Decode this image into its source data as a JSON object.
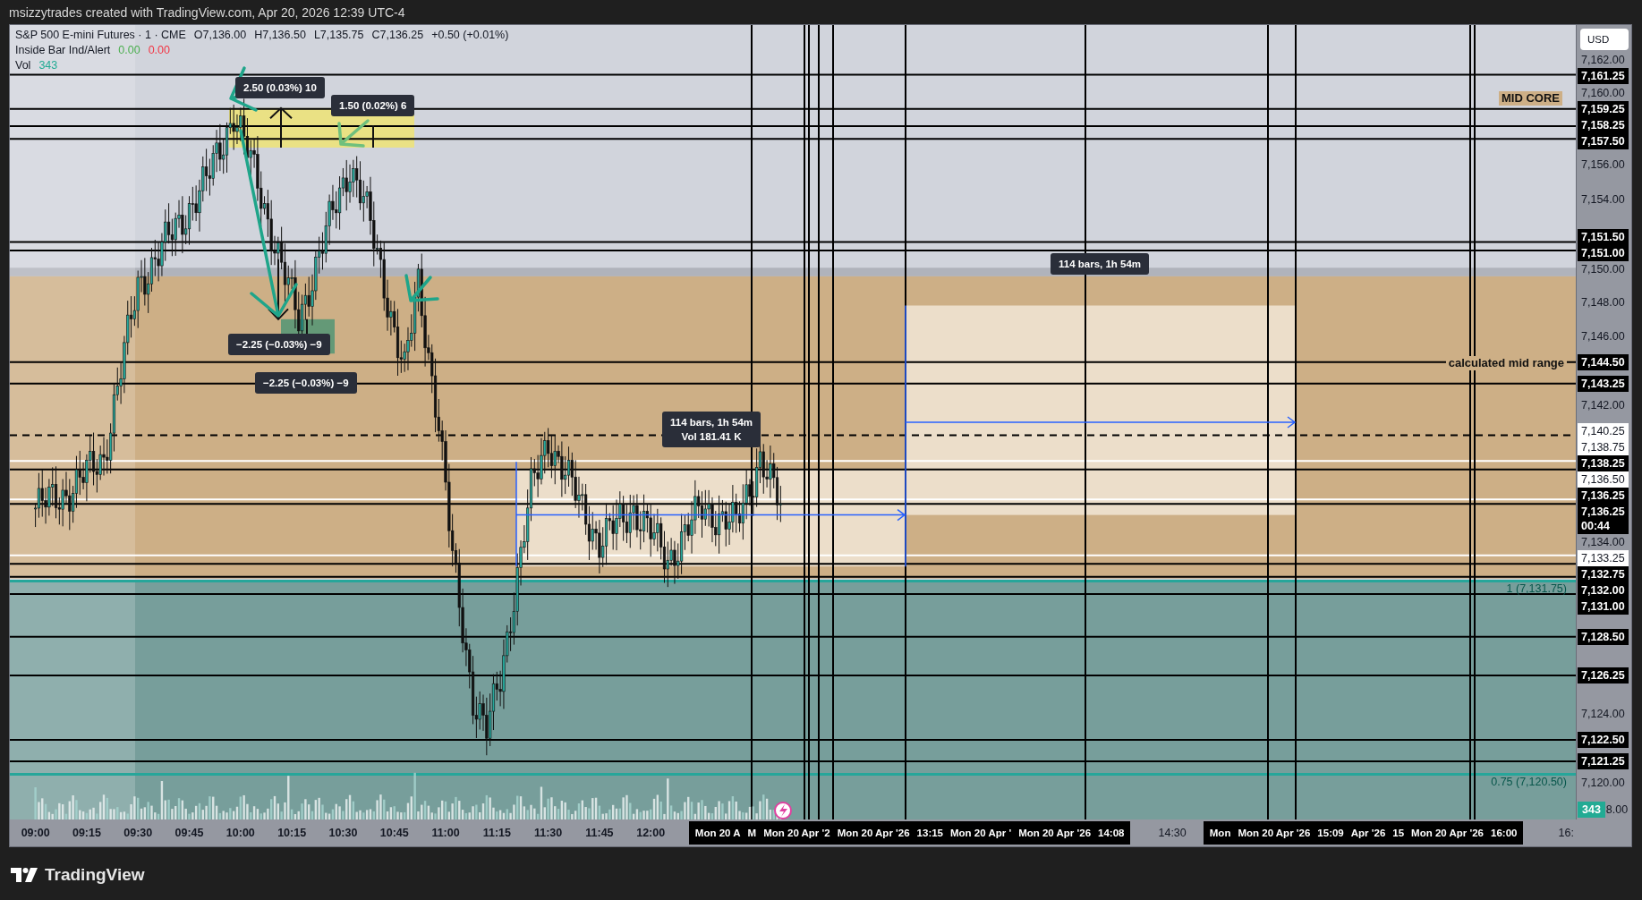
{
  "header": {
    "attribution": "msizzytrades created with TradingView.com, Apr 20, 2026 12:39 UTC-4"
  },
  "legend": {
    "symbol": "S&P 500 E-mini Futures · 1 · CME",
    "ohlc": [
      "O7,136.00",
      "H7,136.50",
      "L7,135.75",
      "C7,136.25"
    ],
    "change": "+0.50 (+0.01%)",
    "indicator": {
      "name": "Inside Bar Ind/Alert",
      "values": [
        {
          "text": "0.00",
          "color": "#4caf50"
        },
        {
          "text": "0.00",
          "color": "#f23645"
        }
      ]
    },
    "volume": {
      "label": "Vol",
      "value": "343"
    }
  },
  "tooltips": [
    {
      "lines": [
        "2.50 (0.03%) 10"
      ]
    },
    {
      "lines": [
        "1.50 (0.02%) 6"
      ]
    },
    {
      "lines": [
        "−2.25 (−0.03%) −9"
      ]
    },
    {
      "lines": [
        "−2.25 (−0.03%) −9"
      ]
    },
    {
      "lines": [
        "114 bars, 1h 54m"
      ]
    },
    {
      "lines": [
        "114 bars, 1h 54m",
        "Vol 181.41 K"
      ]
    }
  ],
  "line_labels": [
    {
      "text": "MID CORE",
      "kind": "bold"
    },
    {
      "text": "calculated mid range",
      "kind": "bold"
    },
    {
      "text": "1 (7,131.75)",
      "kind": "fib"
    },
    {
      "text": "0.75 (7,120.50)",
      "kind": "fib"
    }
  ],
  "price_axis": {
    "currency": "USD",
    "labels": [
      {
        "text": "7,162.00",
        "kind": "tick"
      },
      {
        "text": "7,161.25",
        "kind": "line"
      },
      {
        "text": "7,160.00",
        "kind": "tick"
      },
      {
        "text": "7,159.25",
        "kind": "line"
      },
      {
        "text": "7,158.25",
        "kind": "line"
      },
      {
        "text": "7,157.50",
        "kind": "line"
      },
      {
        "text": "7,156.00",
        "kind": "tick"
      },
      {
        "text": "7,154.00",
        "kind": "tick"
      },
      {
        "text": "7,151.50",
        "kind": "line"
      },
      {
        "text": "7,151.00",
        "kind": "line"
      },
      {
        "text": "7,150.00",
        "kind": "tick"
      },
      {
        "text": "7,148.00",
        "kind": "tick"
      },
      {
        "text": "7,146.00",
        "kind": "tick"
      },
      {
        "text": "7,144.50",
        "kind": "line"
      },
      {
        "text": "7,143.25",
        "kind": "line"
      },
      {
        "text": "7,142.00",
        "kind": "tick"
      },
      {
        "text": "7,140.25",
        "kind": "dashed"
      },
      {
        "text": "7,138.75",
        "kind": "white-line"
      },
      {
        "text": "7,138.25",
        "kind": "line"
      },
      {
        "text": "7,136.50",
        "kind": "white-line"
      },
      {
        "text": "7,136.25",
        "kind": "line"
      },
      {
        "text": "7,136.25",
        "kind": "price",
        "countdown": "00:44"
      },
      {
        "text": "7,134.00",
        "kind": "tick"
      },
      {
        "text": "7,133.25",
        "kind": "white-line"
      },
      {
        "text": "7,132.75",
        "kind": "line"
      },
      {
        "text": "7,132.00",
        "kind": "line"
      },
      {
        "text": "7,131.00",
        "kind": "line"
      },
      {
        "text": "7,128.50",
        "kind": "line"
      },
      {
        "text": "7,126.25",
        "kind": "line"
      },
      {
        "text": "7,124.00",
        "kind": "tick"
      },
      {
        "text": "7,122.50",
        "kind": "line"
      },
      {
        "text": "7,121.25",
        "kind": "line"
      },
      {
        "text": "7,120.00",
        "kind": "tick"
      }
    ],
    "volume_badge": "343",
    "partial_tick": "8.00"
  },
  "time_axis": [
    {
      "kind": "ticks",
      "labels": [
        "09:00",
        "09:15",
        "09:30",
        "09:45",
        "10:00",
        "10:15",
        "10:30",
        "10:45",
        "11:00",
        "11:15",
        "11:30",
        "11:45",
        "12:00"
      ]
    },
    {
      "kind": "cursor",
      "labels": [
        "Mon 20 A",
        "M",
        "Mon 20 Apr '2",
        "Mon 20 Apr '26",
        "13:15",
        "Mon 20 Apr '",
        "Mon 20 Apr '26",
        "14:08"
      ]
    },
    {
      "kind": "ticks",
      "labels": [
        "14:30"
      ]
    },
    {
      "kind": "cursor",
      "labels": [
        "Mon",
        "Mon 20 Apr '26",
        "15:09",
        "Apr '26",
        "15",
        "Mon 20 Apr '26",
        "16:00"
      ]
    },
    {
      "kind": "ticks",
      "labels": [
        "16:"
      ]
    }
  ],
  "footer": {
    "brand": "TradingView"
  }
}
